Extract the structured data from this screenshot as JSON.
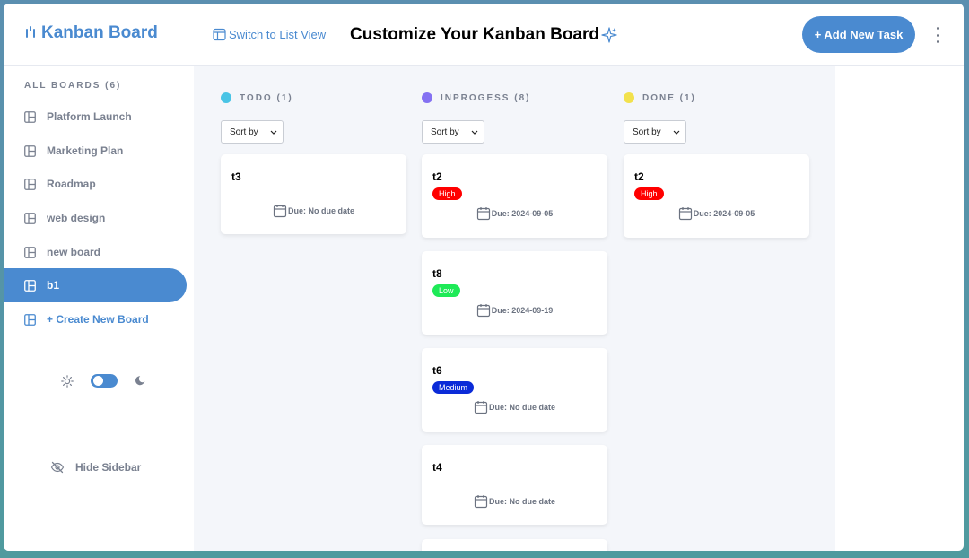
{
  "header": {
    "logo_text": "Kanban Board",
    "switch_view_label": "Switch to List View",
    "page_title": "Customize Your Kanban Board",
    "add_task_label": "+ Add New Task"
  },
  "sidebar": {
    "all_boards_label": "ALL BOARDS (6)",
    "boards": [
      {
        "label": "Platform Launch",
        "active": false
      },
      {
        "label": "Marketing Plan",
        "active": false
      },
      {
        "label": "Roadmap",
        "active": false
      },
      {
        "label": "web design",
        "active": false
      },
      {
        "label": "new board",
        "active": false
      },
      {
        "label": "b1",
        "active": true
      }
    ],
    "create_board_label": "+ Create New Board",
    "hide_sidebar_label": "Hide Sidebar",
    "theme_toggle": {
      "dark_mode": false
    }
  },
  "columns": [
    {
      "title": "TODO (1)",
      "dot_color": "#49c4e5",
      "sort_label": "Sort by",
      "cards": [
        {
          "title": "t3",
          "priority": "",
          "due": "Due: No due date"
        }
      ]
    },
    {
      "title": "INPROGESS (8)",
      "dot_color": "#8471f2",
      "sort_label": "Sort by",
      "cards": [
        {
          "title": "t2",
          "priority": "High",
          "priority_color": "#ff0000",
          "due": "Due: 2024-09-05"
        },
        {
          "title": "t8",
          "priority": "Low",
          "priority_color": "#1eea57",
          "due": "Due: 2024-09-19"
        },
        {
          "title": "t6",
          "priority": "Medium",
          "priority_color": "#0b2bd8",
          "due": "Due: No due date"
        },
        {
          "title": "t4",
          "priority": "",
          "due": "Due: No due date"
        }
      ]
    },
    {
      "title": "DONE (1)",
      "dot_color": "#f2e14c",
      "sort_label": "Sort by",
      "cards": [
        {
          "title": "t2",
          "priority": "High",
          "priority_color": "#ff0000",
          "due": "Due: 2024-09-05"
        }
      ]
    }
  ],
  "colors": {
    "accent": "#4a8ad0",
    "board_bg": "#f4f6fa"
  },
  "icons": {
    "board": "board-icon",
    "sun": "sun-icon",
    "moon": "moon-icon",
    "hide": "eye-slash-icon",
    "calendar": "calendar-icon",
    "sparkle": "sparkle-icon",
    "table": "table-icon",
    "more": "more-vertical-icon"
  }
}
